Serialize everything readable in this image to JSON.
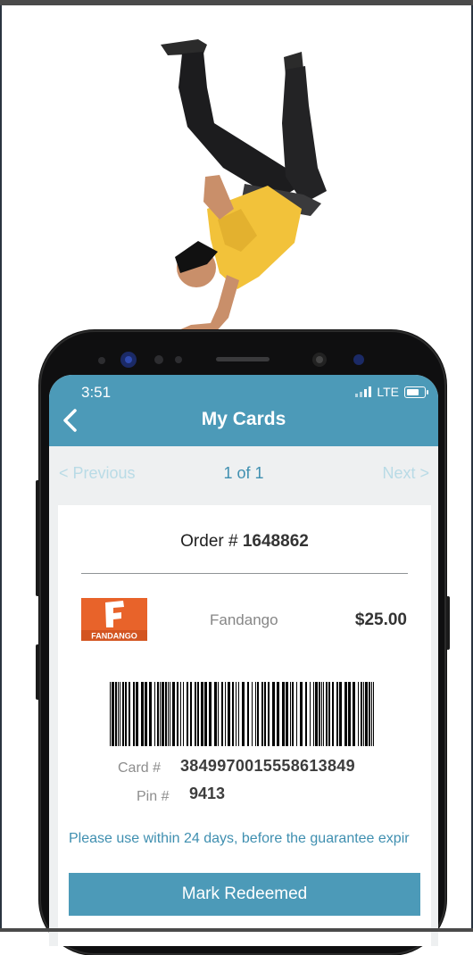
{
  "status_bar": {
    "time": "3:51",
    "network": "LTE"
  },
  "header": {
    "title": "My Cards"
  },
  "pager": {
    "previous_label": "< Previous",
    "count_label": "1 of 1",
    "next_label": "Next >"
  },
  "order": {
    "prefix": "Order # ",
    "number": "1648862"
  },
  "gift_card": {
    "brand": "Fandango",
    "logo_text": "FANDANGO",
    "amount": "$25.00",
    "card_label": "Card #",
    "card_number": "3849970015558613849",
    "pin_label": "Pin #",
    "pin_number": "9413"
  },
  "notice": "Please use within 24 days, before the guarantee expir",
  "actions": {
    "mark_redeemed_label": "Mark Redeemed"
  },
  "colors": {
    "brand_teal": "#4c9ab8",
    "link_teal": "#3f8fb0",
    "fandango_orange": "#e8632a"
  }
}
